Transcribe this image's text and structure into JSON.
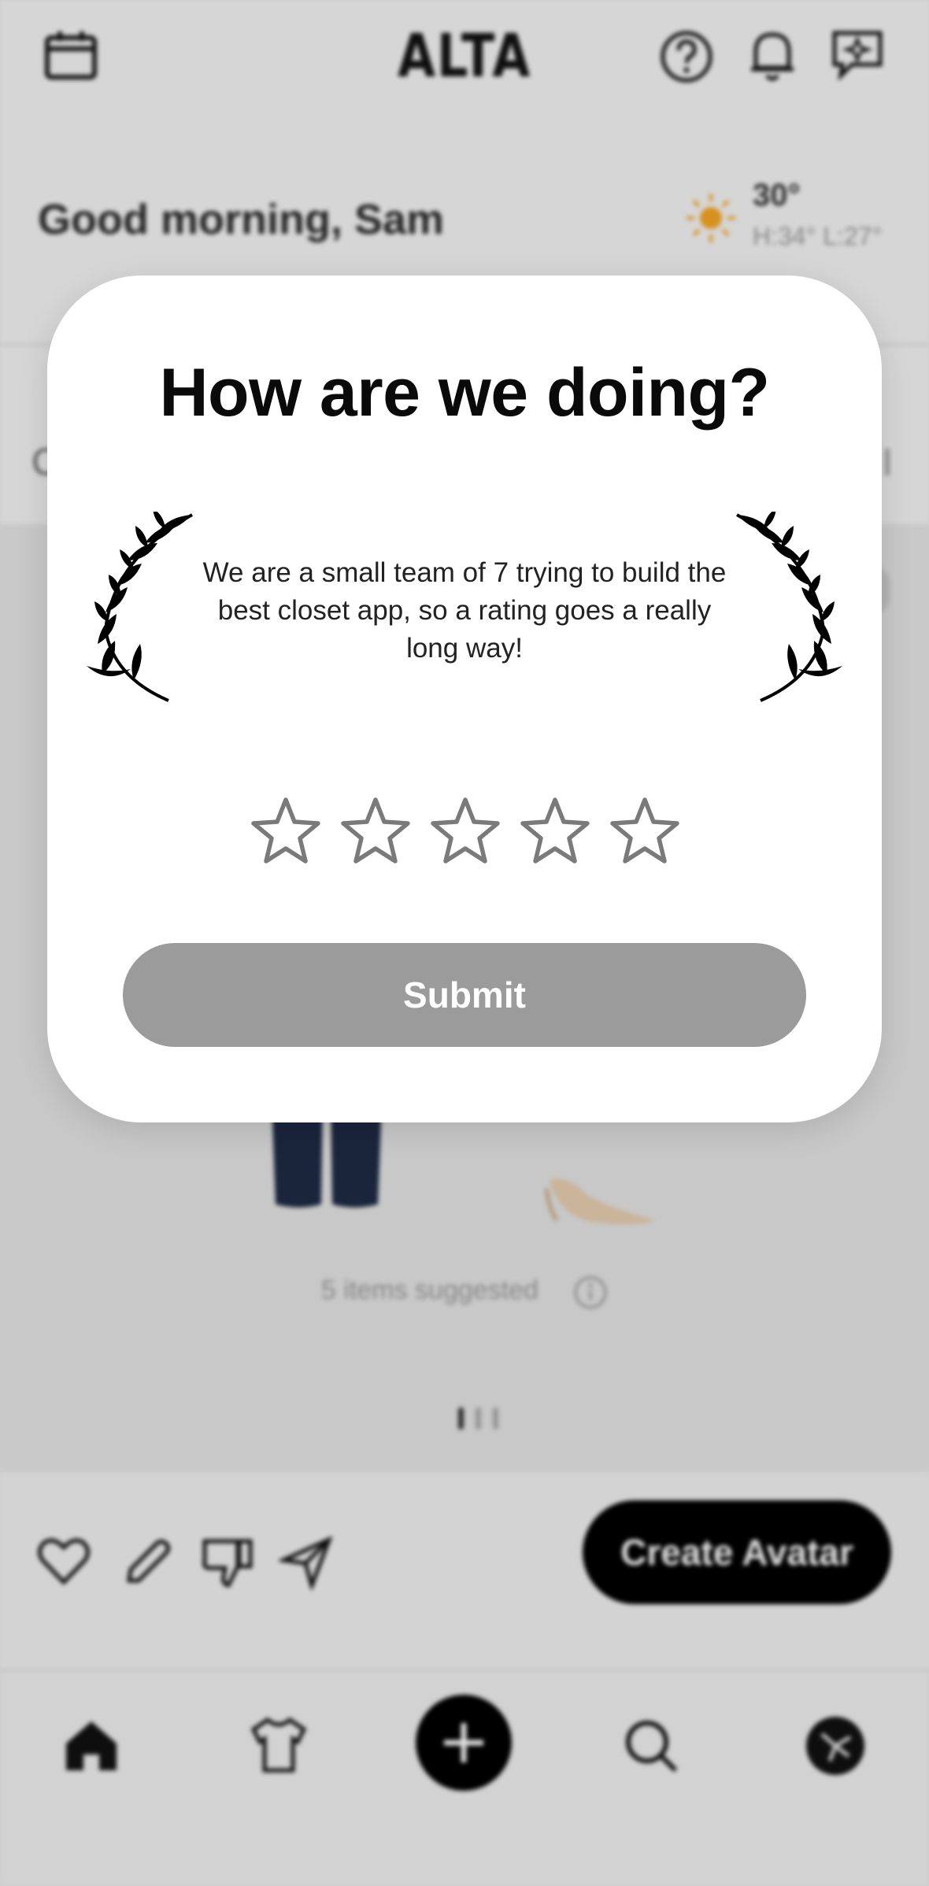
{
  "app": {
    "logo": "ALTA",
    "greeting": "Good morning, Sam",
    "weather": {
      "temp": "30°",
      "high_low": "H:34° L:27°",
      "icon": "sun-icon"
    },
    "ghost_tab_letter": "C",
    "suggestion_text": "5 items suggested",
    "pager": {
      "pages": 3,
      "current": 1
    },
    "actions": {
      "create_avatar_label": "Create Avatar"
    },
    "icons": [
      "calendar-icon",
      "help-icon",
      "bell-icon",
      "chat-sparkle-icon",
      "heart-icon",
      "pencil-icon",
      "thumbs-down-icon",
      "send-icon",
      "home-icon",
      "shirt-icon",
      "plus-icon",
      "search-icon",
      "profile-icon"
    ]
  },
  "modal": {
    "title": "How are we doing?",
    "message": "We are a small team of 7 trying to build the best closet app, so a rating goes a really long way!",
    "rating": {
      "max": 5,
      "value": 0
    },
    "submit_label": "Submit"
  },
  "colors": {
    "submit_disabled": "#9b9b9b",
    "primary": "#000000",
    "sun": "#f5a623"
  }
}
